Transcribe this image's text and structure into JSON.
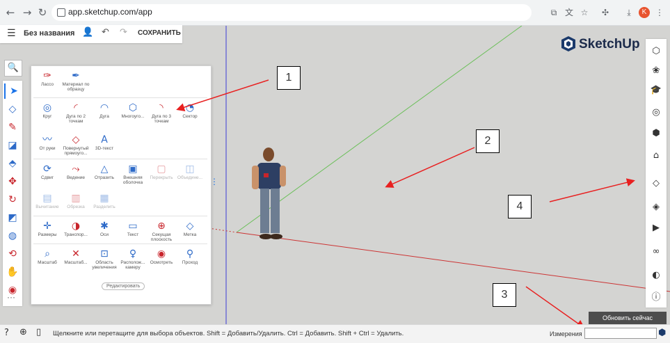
{
  "browser": {
    "url": "app.sketchup.com/app",
    "nav_back": "←",
    "nav_forward": "→",
    "nav_reload": "↻",
    "profile_initial": "K"
  },
  "header": {
    "title": "Без названия",
    "save_label": "СОХРАНИТЬ"
  },
  "brand": "SketchUp",
  "panel": {
    "tools": [
      {
        "label": "Лассо",
        "icon": "lasso-icon"
      },
      {
        "label": "Материал по образцу",
        "icon": "eyedropper-icon"
      },
      {
        "label": "Круг",
        "icon": "circle-icon"
      },
      {
        "label": "Дуга по 2 точкам",
        "icon": "arc-2pt-icon"
      },
      {
        "label": "Дуга",
        "icon": "arc-icon"
      },
      {
        "label": "Многоуго...",
        "icon": "polygon-icon"
      },
      {
        "label": "Дуга по 3 точкам",
        "icon": "arc-3pt-icon"
      },
      {
        "label": "Сектор",
        "icon": "pie-icon"
      },
      {
        "label": "От руки",
        "icon": "freehand-icon"
      },
      {
        "label": "Повернутый прямоуго...",
        "icon": "rotated-rect-icon"
      },
      {
        "label": "3D-текст",
        "icon": "3d-text-icon"
      },
      {
        "label": "Сдвиг",
        "icon": "offset-icon"
      },
      {
        "label": "Ведение",
        "icon": "follow-me-icon"
      },
      {
        "label": "Отразить",
        "icon": "flip-icon"
      },
      {
        "label": "Внешняя оболочка",
        "icon": "outer-shell-icon"
      },
      {
        "label": "Перекрыть",
        "icon": "intersect-icon"
      },
      {
        "label": "Объедине...",
        "icon": "union-icon"
      },
      {
        "label": "Вычитание",
        "icon": "subtract-icon"
      },
      {
        "label": "Обрезка",
        "icon": "trim-icon"
      },
      {
        "label": "Разделить",
        "icon": "split-icon"
      },
      {
        "label": "Размеры",
        "icon": "dimensions-icon"
      },
      {
        "label": "Транспор...",
        "icon": "protractor-icon"
      },
      {
        "label": "Оси",
        "icon": "axes-icon"
      },
      {
        "label": "Текст",
        "icon": "text-icon"
      },
      {
        "label": "Секущая плоскость",
        "icon": "section-plane-icon"
      },
      {
        "label": "Метка",
        "icon": "tag-icon"
      },
      {
        "label": "Масштаб",
        "icon": "zoom-icon"
      },
      {
        "label": "Масштаб...",
        "icon": "zoom-extents-icon"
      },
      {
        "label": "Область увеличения",
        "icon": "zoom-window-icon"
      },
      {
        "label": "Располож... камеру",
        "icon": "position-camera-icon"
      },
      {
        "label": "Осмотреть",
        "icon": "look-around-icon"
      },
      {
        "label": "Проход",
        "icon": "walk-icon"
      }
    ],
    "edit_button": "Редактировать"
  },
  "annotations": [
    "1",
    "2",
    "3",
    "4"
  ],
  "update_button": "Обновить сейчас",
  "status": {
    "hint": "Щелкните или перетащите для выбора объектов. Shift = Добавить/Удалить. Ctrl = Добавить. Shift + Ctrl = Удалить.",
    "measure_label": "Измерения",
    "measure_value": ""
  },
  "colors": {
    "accent": "#1a73e8",
    "arrow": "#e82020",
    "red_axis": "#cc3333",
    "green_axis": "#6bbf59",
    "blue_axis": "#3b3bd6",
    "dark_button": "#4d4d4d"
  }
}
